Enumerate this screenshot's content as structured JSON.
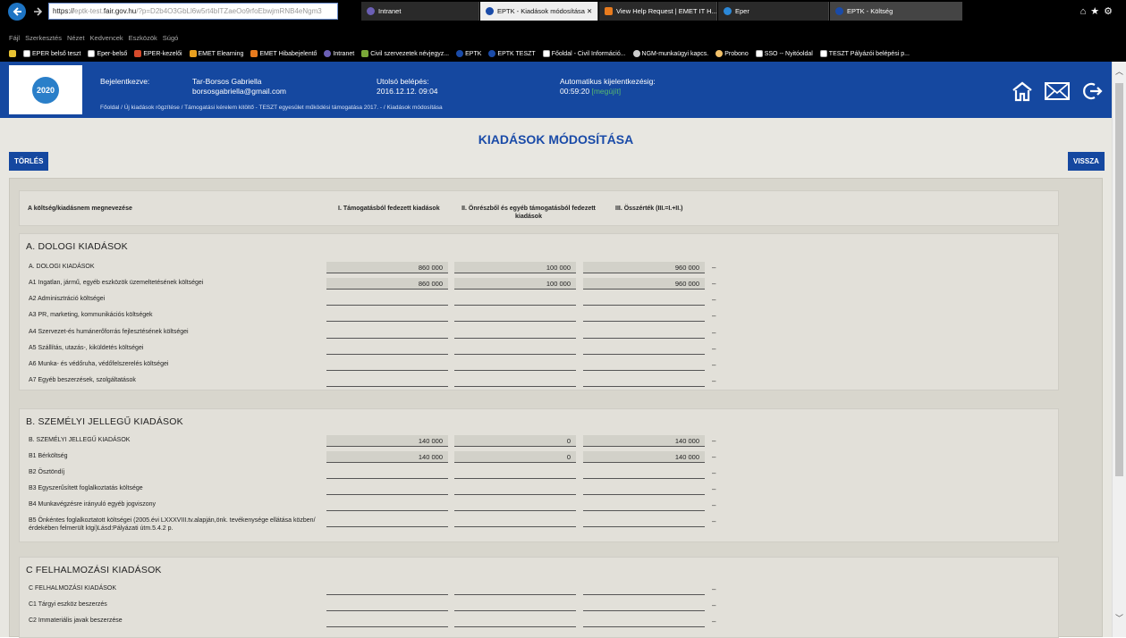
{
  "browser": {
    "url_prefix": "https://",
    "url_host_a": "eptk-test.",
    "url_host_b": "fair.gov.hu",
    "url_rest": "/?p=D2b4O3GbLl6w5rt4bITZaeOo9rfoEbwjmRNB4eNgm3",
    "tabs": [
      {
        "label": "Intranet"
      },
      {
        "label": "EPTK - Kiadások módosítása  ✕"
      },
      {
        "label": "View Help Request | EMET IT H..."
      },
      {
        "label": "Eper"
      },
      {
        "label": "EPTK - Költség"
      }
    ],
    "menu": [
      "Fájl",
      "Szerkesztés",
      "Nézet",
      "Kedvencek",
      "Eszközök",
      "Súgó"
    ],
    "favorites": [
      "EPER belső teszt",
      "Eper-belső",
      "EPER-kezelői",
      "EMET Elearning",
      "EMET Hibabejelentő",
      "Intranet",
      "Civil szervezetek névjegyz...",
      "EPTK",
      "EPTK TESZT",
      "Főoldal - Civil Információ...",
      "NGM-munkaügyi kapcs.",
      "Probono",
      "SSO -- Nyitóoldal",
      "TESZT  Pályázói belépési p..."
    ]
  },
  "header": {
    "logo_text": "2020",
    "logged_in_label": "Bejelentkezve:",
    "user_name": "Tar-Borsos Gabriella",
    "user_email": "borsosgabriella@gmail.com",
    "last_login_label": "Utolsó belépés:",
    "last_login_value": "2016.12.12. 09:04",
    "auto_logout_label": "Automatikus kijelentkezésig:",
    "auto_logout_value": "00:59:20",
    "auto_logout_link": "[megújít]",
    "breadcrumb": "Főoldal   /   Új kiadások rögzítése   /   Támogatási kérelem kitöltő - TESZT egyesület működési támogatása 2017. -   /   Kiadások módosítása"
  },
  "page": {
    "title": "KIADÁSOK MÓDOSÍTÁSA",
    "delete_button": "TÖRLÉS",
    "back_button": "VISSZA"
  },
  "table": {
    "col_name": "A költség/kiadásnem megnevezése",
    "col_1": "I. Támogatásból fedezett kiadások",
    "col_2": "II. Önrészből és egyéb támogatásból fedezett kiadások",
    "col_3": "III. Összérték (III.=I.+II.)",
    "sections": [
      {
        "title": "A. DOLOGI KIADÁSOK",
        "rows": [
          {
            "label": "A. DOLOGI KIADÁSOK",
            "v1": "860 000",
            "v2": "100 000",
            "v3": "960 000"
          },
          {
            "label": "A1 Ingatlan, jármű, egyéb eszközök üzemeltetésének költségei",
            "v1": "860 000",
            "v2": "100 000",
            "v3": "960 000"
          },
          {
            "label": "A2 Adminisztráció költségei",
            "v1": "",
            "v2": "",
            "v3": ""
          },
          {
            "label": "A3 PR, marketing, kommunikációs költségek",
            "v1": "",
            "v2": "",
            "v3": ""
          },
          {
            "label": "A4 Szervezet-és humánerőforrás fejlesztésének költségei",
            "v1": "",
            "v2": "",
            "v3": ""
          },
          {
            "label": "A5 Szállítás, utazás-, kiküldetés költségei",
            "v1": "",
            "v2": "",
            "v3": ""
          },
          {
            "label": "A6 Munka- és védőruha, védőfelszerelés költségei",
            "v1": "",
            "v2": "",
            "v3": ""
          },
          {
            "label": "A7 Egyéb beszerzések, szolgáltatások",
            "v1": "",
            "v2": "",
            "v3": ""
          }
        ]
      },
      {
        "title": "B. SZEMÉLYI JELLEGŰ KIADÁSOK",
        "rows": [
          {
            "label": "B. SZEMÉLYI JELLEGŰ KIADÁSOK",
            "v1": "140 000",
            "v2": "0",
            "v3": "140 000"
          },
          {
            "label": "B1 Bérköltség",
            "v1": "140 000",
            "v2": "0",
            "v3": "140 000"
          },
          {
            "label": "B2 Ösztöndíj",
            "v1": "",
            "v2": "",
            "v3": ""
          },
          {
            "label": "B3 Egyszerűsített foglalkoztatás költsége",
            "v1": "",
            "v2": "",
            "v3": ""
          },
          {
            "label": "B4 Munkavégzésre irányuló egyéb jogviszony",
            "v1": "",
            "v2": "",
            "v3": ""
          },
          {
            "label": "B5 Önkéntes foglalkoztatott költségei (2005.évi LXXXVIII.tv.alapján,önk. tevékenysége ellátása közben/érdekében felmerült ktgi)Lásd:Pályázati útm.5.4.2 p.",
            "v1": "",
            "v2": "",
            "v3": ""
          }
        ]
      },
      {
        "title": "C FELHALMOZÁSI KIADÁSOK",
        "rows": [
          {
            "label": "C FELHALMOZÁSI KIADÁSOK",
            "v1": "",
            "v2": "",
            "v3": ""
          },
          {
            "label": "C1 Tárgyi eszköz beszerzés",
            "v1": "",
            "v2": "",
            "v3": ""
          },
          {
            "label": "C2 Immateriális javak beszerzése",
            "v1": "",
            "v2": "",
            "v3": ""
          }
        ]
      }
    ],
    "dash": "–"
  }
}
